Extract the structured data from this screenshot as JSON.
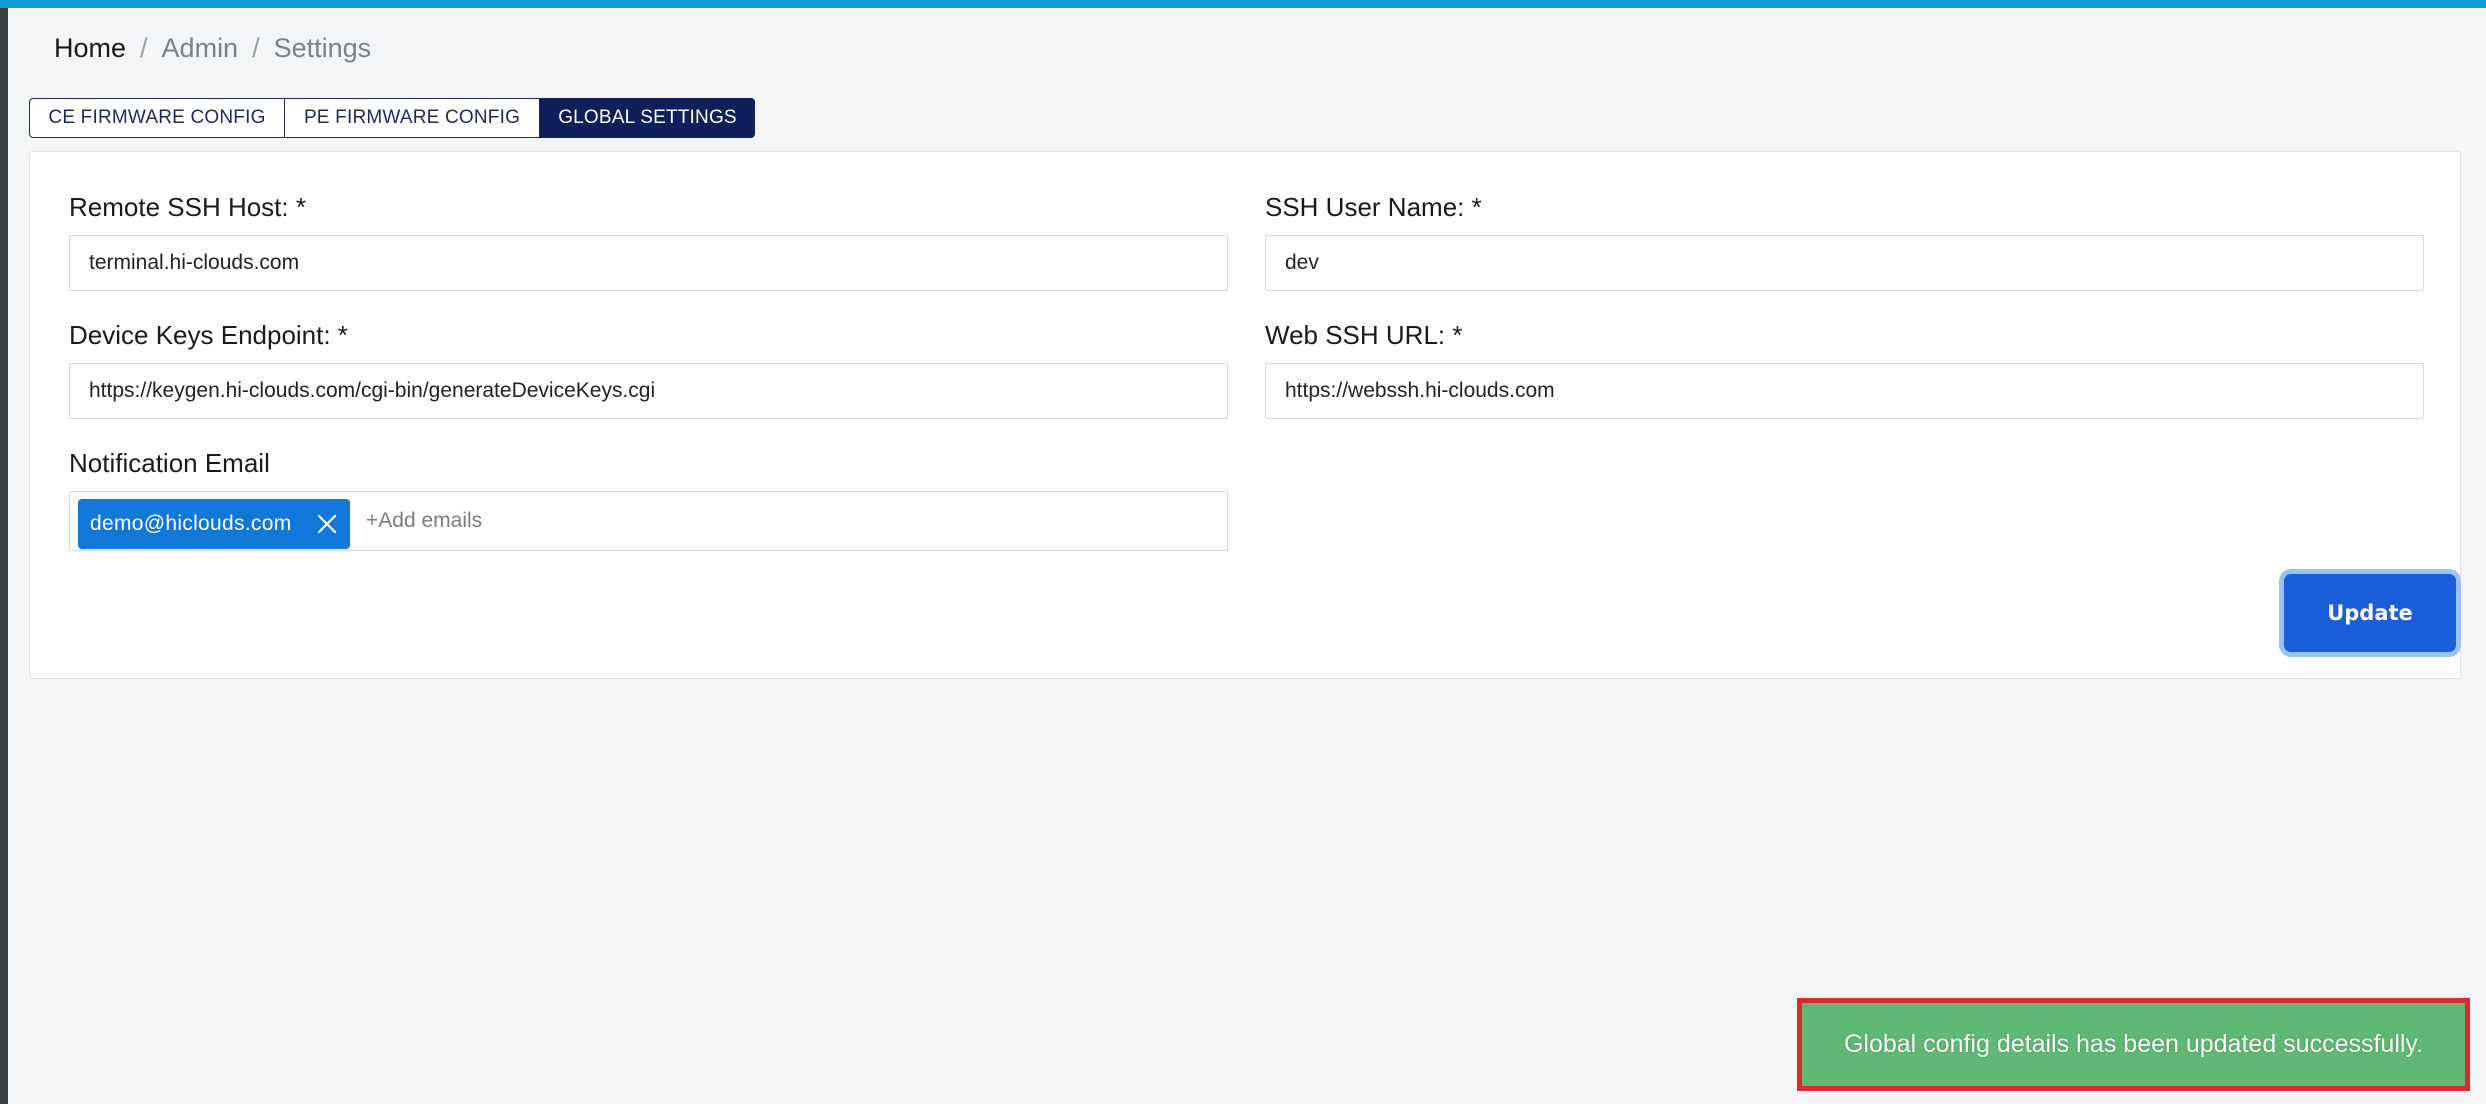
{
  "breadcrumb": {
    "home": "Home",
    "separator": "/",
    "admin": "Admin",
    "settings": "Settings"
  },
  "tabs": [
    {
      "label": "CE FIRMWARE CONFIG",
      "active": false
    },
    {
      "label": "PE FIRMWARE CONFIG",
      "active": false
    },
    {
      "label": "GLOBAL SETTINGS",
      "active": true
    }
  ],
  "form": {
    "remote_ssh_host": {
      "label": "Remote SSH Host: *",
      "value": "terminal.hi-clouds.com"
    },
    "ssh_user_name": {
      "label": "SSH User Name: *",
      "value": "dev"
    },
    "device_keys_endpoint": {
      "label": "Device Keys Endpoint: *",
      "value": "https://keygen.hi-clouds.com/cgi-bin/generateDeviceKeys.cgi"
    },
    "web_ssh_url": {
      "label": "Web SSH URL: *",
      "value": "https://webssh.hi-clouds.com"
    },
    "notification_email": {
      "label": "Notification Email",
      "chips": [
        "demo@hiclouds.com"
      ],
      "placeholder": "+Add emails"
    },
    "update_label": "Update"
  },
  "toast": {
    "message": "Global config details has been updated successfully."
  },
  "colors": {
    "top_bar": "#0e9bd8",
    "tab_active": "#0f1f5c",
    "chip": "#1177d8",
    "update_button": "#1a5edb",
    "toast_bg": "#5fb974",
    "toast_highlight": "#e0262f"
  }
}
